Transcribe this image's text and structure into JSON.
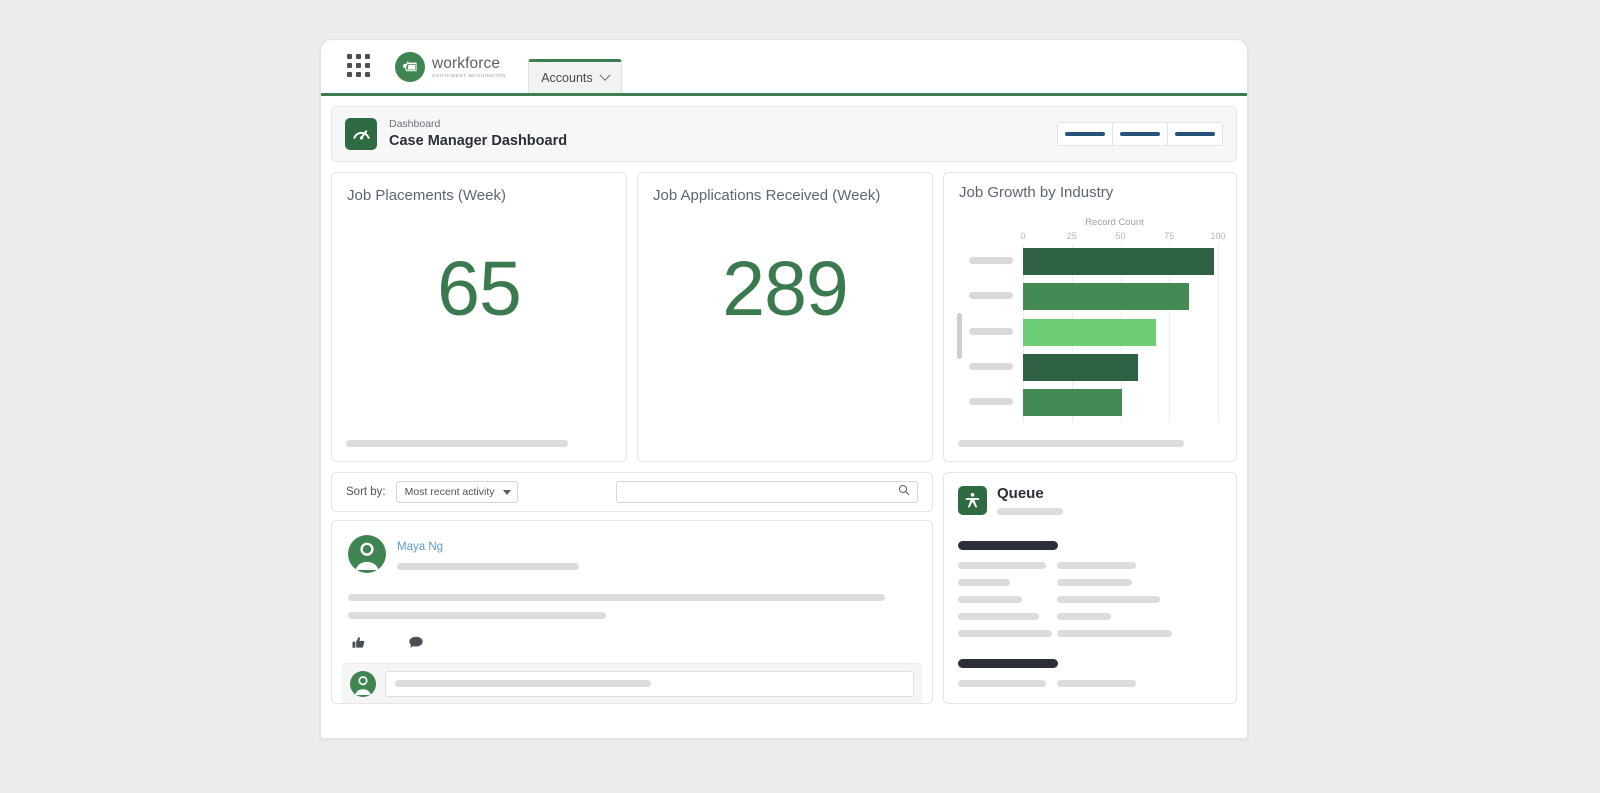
{
  "nav": {
    "app_launcher_icon": "app-launcher-grid-icon",
    "brand_name": "workforce",
    "brand_subtitle": "SOUTHWEST WASHINGTON",
    "brand_icon": "washington-state-logo-icon",
    "tab_label": "Accounts",
    "tab_chevron_icon": "chevron-down-icon"
  },
  "header": {
    "icon": "gauge-dashboard-icon",
    "eyebrow": "Dashboard",
    "title": "Case Manager Dashboard",
    "actions": [
      "",
      "",
      ""
    ]
  },
  "kpis": [
    {
      "title": "Job Placements (Week)",
      "value": "65",
      "color": "#3b7a4e"
    },
    {
      "title": "Job Applications Received (Week)",
      "value": "289",
      "color": "#3b7a4e"
    }
  ],
  "chart_card": {
    "title": "Job Growth by Industry"
  },
  "chart_data": {
    "type": "bar",
    "orientation": "horizontal",
    "title": "Job Growth by Industry",
    "xlabel": "Record Count",
    "ylabel": "",
    "categories": [
      "",
      "",
      "",
      "",
      ""
    ],
    "values": [
      98,
      85,
      68,
      59,
      51
    ],
    "colors": [
      "#2e6144",
      "#448a55",
      "#6ccd74",
      "#2e6144",
      "#448a55"
    ],
    "ticks": [
      0,
      25,
      50,
      75,
      100
    ],
    "xlim": [
      0,
      100
    ],
    "grid": true,
    "legend": false
  },
  "feed": {
    "sort_label": "Sort by:",
    "sort_value": "Most recent activity",
    "sort_caret_icon": "caret-down-icon",
    "search_placeholder": "",
    "search_value": "",
    "search_icon": "search-icon",
    "post": {
      "avatar_icon": "user-avatar-icon",
      "author": "Maya Ng",
      "like_icon": "thumbs-up-icon",
      "comment_icon": "comment-bubble-icon",
      "comment_avatar_icon": "user-avatar-icon"
    }
  },
  "queue": {
    "icon": "queue-person-star-icon",
    "title": "Queue"
  }
}
